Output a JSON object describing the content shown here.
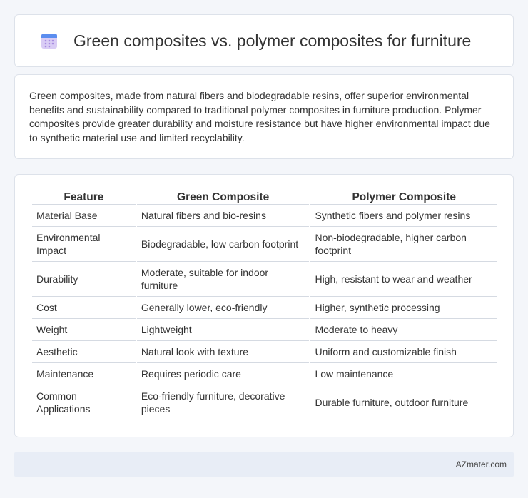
{
  "header": {
    "title": "Green composites vs. polymer composites for furniture",
    "icon": "calendar-icon"
  },
  "intro": {
    "text": "Green composites, made from natural fibers and biodegradable resins, offer superior environmental benefits and sustainability compared to traditional polymer composites in furniture production. Polymer composites provide greater durability and moisture resistance but have higher environmental impact due to synthetic material use and limited recyclability."
  },
  "table": {
    "headers": [
      "Feature",
      "Green Composite",
      "Polymer Composite"
    ],
    "rows": [
      [
        "Material Base",
        "Natural fibers and bio-resins",
        "Synthetic fibers and polymer resins"
      ],
      [
        "Environmental Impact",
        "Biodegradable, low carbon footprint",
        "Non-biodegradable, higher carbon footprint"
      ],
      [
        "Durability",
        "Moderate, suitable for indoor furniture",
        "High, resistant to wear and weather"
      ],
      [
        "Cost",
        "Generally lower, eco-friendly",
        "Higher, synthetic processing"
      ],
      [
        "Weight",
        "Lightweight",
        "Moderate to heavy"
      ],
      [
        "Aesthetic",
        "Natural look with texture",
        "Uniform and customizable finish"
      ],
      [
        "Maintenance",
        "Requires periodic care",
        "Low maintenance"
      ],
      [
        "Common Applications",
        "Eco-friendly furniture, decorative pieces",
        "Durable furniture, outdoor furniture"
      ]
    ]
  },
  "footer": {
    "brand": "AZmater.com"
  },
  "colors": {
    "icon_top": "#5b8def",
    "icon_body": "#c9b6f2",
    "footer_bg": "#e8edf6"
  }
}
